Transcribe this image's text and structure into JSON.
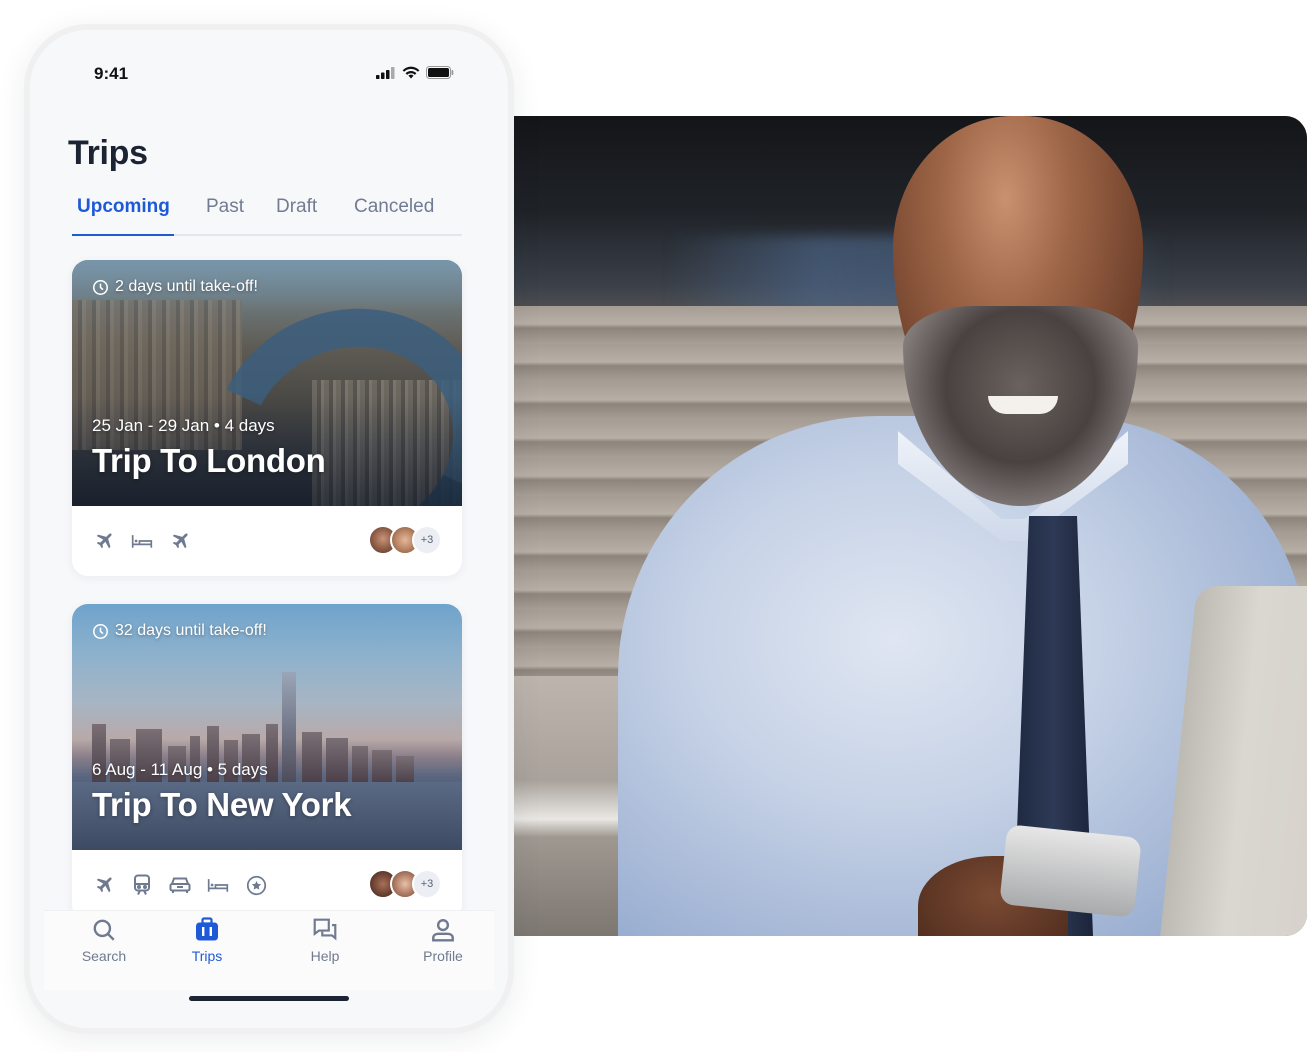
{
  "status_bar": {
    "time": "9:41",
    "icons": [
      "signal-icon",
      "wifi-icon",
      "battery-icon"
    ]
  },
  "header": {
    "title": "Trips"
  },
  "tabs": [
    {
      "label": "Upcoming",
      "active": true
    },
    {
      "label": "Past",
      "active": false
    },
    {
      "label": "Draft",
      "active": false
    },
    {
      "label": "Canceled",
      "active": false
    }
  ],
  "trips": [
    {
      "countdown": "2 days until take-off!",
      "dates": "25  Jan - 29 Jan • 4 days",
      "title": "Trip To London",
      "services": [
        "flight-icon",
        "hotel-icon",
        "flight-icon"
      ],
      "travelers_extra": "+3"
    },
    {
      "countdown": "32 days until take-off!",
      "dates": "6 Aug - 11 Aug • 5 days",
      "title": "Trip To New York",
      "services": [
        "flight-icon",
        "train-icon",
        "car-icon",
        "hotel-icon",
        "star-icon"
      ],
      "travelers_extra": "+3"
    }
  ],
  "bottom_nav": [
    {
      "label": "Search",
      "icon": "search-icon",
      "active": false
    },
    {
      "label": "Trips",
      "icon": "suitcase-icon",
      "active": true
    },
    {
      "label": "Help",
      "icon": "chat-icon",
      "active": false
    },
    {
      "label": "Profile",
      "icon": "user-icon",
      "active": false
    }
  ],
  "colors": {
    "accent": "#1f5ad6",
    "text_dark": "#1c2433",
    "text_muted": "#717c92",
    "icon_gray": "#6f7a90"
  }
}
